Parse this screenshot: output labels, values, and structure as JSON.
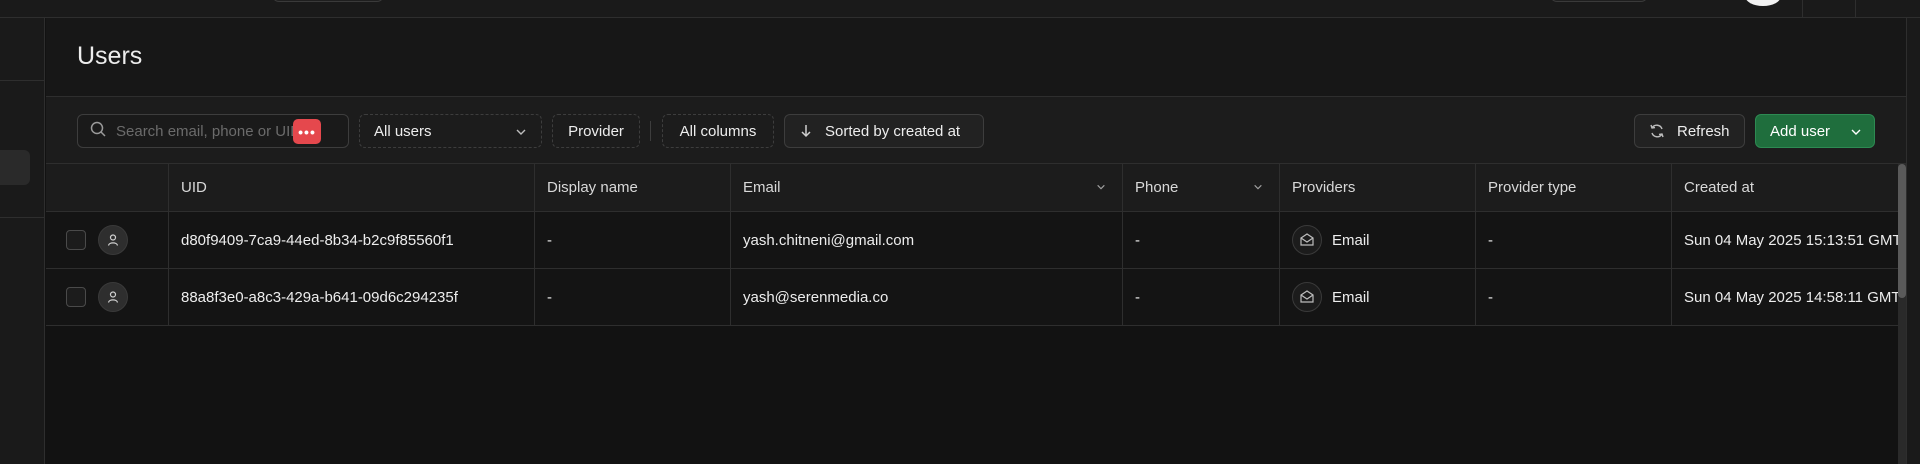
{
  "page": {
    "title": "Users"
  },
  "toolbar": {
    "search_placeholder": "Search email, phone or UID",
    "more_label": "•••",
    "filter_users": "All users",
    "provider": "Provider",
    "columns": "All columns",
    "sort": "Sorted by created at",
    "refresh": "Refresh",
    "add_user": "Add user"
  },
  "table": {
    "columns": [
      "UID",
      "Display name",
      "Email",
      "Phone",
      "Providers",
      "Provider type",
      "Created at"
    ],
    "rows": [
      {
        "uid": "d80f9409-7ca9-44ed-8b34-b2c9f85560f1",
        "display_name": "-",
        "email": "yash.chitneni@gmail.com",
        "phone": "-",
        "provider": "Email",
        "provider_type": "-",
        "created_at": "Sun 04 May 2025 15:13:51 GMT"
      },
      {
        "uid": "88a8f3e0-a8c3-429a-b641-09d6c294235f",
        "display_name": "-",
        "email": "yash@serenmedia.co",
        "phone": "-",
        "provider": "Email",
        "provider_type": "-",
        "created_at": "Sun 04 May 2025 14:58:11 GMT"
      }
    ]
  },
  "colors": {
    "background": "#121212",
    "accent_green": "#1f6e3d",
    "danger": "#e5484d"
  }
}
